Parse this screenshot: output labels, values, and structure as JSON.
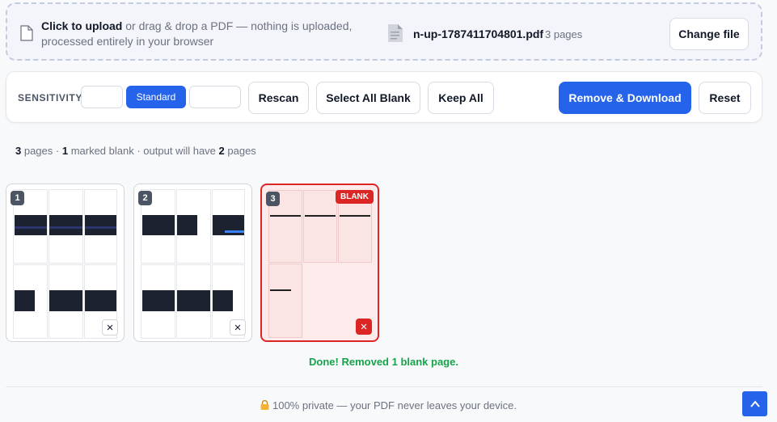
{
  "upload": {
    "bold": "Click to upload",
    "rest": " or drag & drop a PDF — nothing is uploaded, processed entirely in your browser",
    "file_name": "n-up-1787411704801.pdf",
    "file_pages": "3 pages",
    "change_label": "Change file"
  },
  "toolbar": {
    "sensitivity_label": "SENSITIVITY",
    "sensitivity_options": [
      "",
      "Standard",
      ""
    ],
    "rescan": "Rescan",
    "select_all_blank": "Select All Blank",
    "keep_all": "Keep All",
    "remove_download": "Remove & Download",
    "reset": "Reset"
  },
  "summary": {
    "total": "3",
    "total_label": " pages",
    "sep1": " · ",
    "marked": "1",
    "marked_label": " marked blank",
    "sep2": " · ",
    "output_label": "output will have ",
    "output": "2",
    "output_suffix": " pages"
  },
  "pages": [
    {
      "number": "1",
      "blank": false
    },
    {
      "number": "2",
      "blank": false
    },
    {
      "number": "3",
      "blank": true,
      "badge": "BLANK"
    }
  ],
  "icons": {
    "remove": "×"
  },
  "status": "Done! Removed 1 blank page.",
  "footer": "100% private — your PDF never leaves your device.",
  "colors": {
    "accent": "#2563eb",
    "danger": "#dc2626",
    "success": "#16a34a"
  }
}
